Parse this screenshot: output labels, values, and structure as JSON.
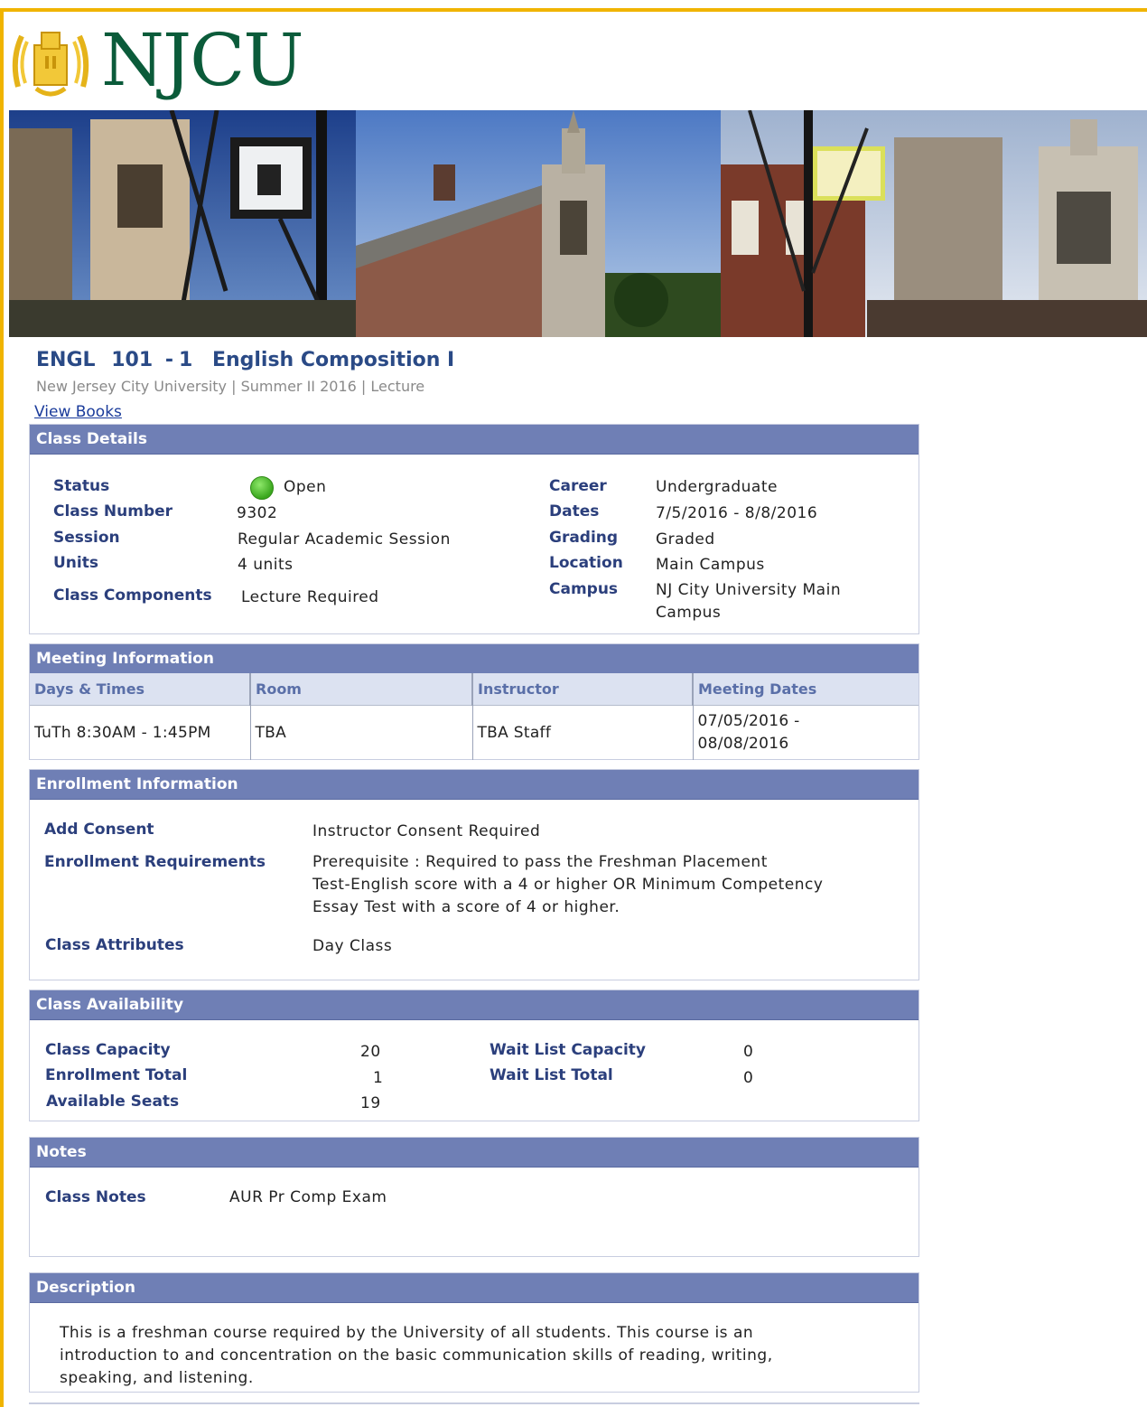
{
  "brand": {
    "logo_text": "NJCU",
    "accent_color": "#f0b400",
    "header_color": "#6f7fb5",
    "label_color": "#2b3f7c",
    "logo_color": "#0b5b3a"
  },
  "course": {
    "subject": "ENGL",
    "number": "101",
    "section": "1",
    "title": "English Composition I",
    "institution": "New Jersey City University",
    "term": "Summer II 2016",
    "component": "Lecture",
    "view_books": "View Books"
  },
  "class_details": {
    "heading": "Class Details",
    "status_label": "Status",
    "status_value": "Open",
    "status_icon": "open-status-icon",
    "class_number_label": "Class Number",
    "class_number_value": "9302",
    "session_label": "Session",
    "session_value": "Regular Academic Session",
    "units_label": "Units",
    "units_value": "4 units",
    "components_label": "Class Components",
    "components_value": "Lecture Required",
    "career_label": "Career",
    "career_value": "Undergraduate",
    "dates_label": "Dates",
    "dates_value": "7/5/2016 - 8/8/2016",
    "grading_label": "Grading",
    "grading_value": "Graded",
    "location_label": "Location",
    "location_value": "Main Campus",
    "campus_label": "Campus",
    "campus_value_1": "NJ City University Main",
    "campus_value_2": "Campus"
  },
  "meeting": {
    "heading": "Meeting Information",
    "columns": [
      "Days & Times",
      "Room",
      "Instructor",
      "Meeting Dates"
    ],
    "rows": [
      {
        "days_times": "TuTh 8:30AM - 1:45PM",
        "room": "TBA",
        "instructor": "TBA Staff",
        "dates_1": "07/05/2016 -",
        "dates_2": "08/08/2016"
      }
    ]
  },
  "enrollment": {
    "heading": "Enrollment Information",
    "consent_label": "Add Consent",
    "consent_value": "Instructor Consent Required",
    "requirements_label": "Enrollment Requirements",
    "requirements_line_1": "Prerequisite :  Required to pass the Freshman Placement",
    "requirements_line_2": "Test-English score with a 4 or higher OR Minimum Competency",
    "requirements_line_3": "Essay Test with a score of 4 or higher.",
    "attributes_label": "Class Attributes",
    "attributes_value": "Day Class"
  },
  "availability": {
    "heading": "Class Availability",
    "capacity_label": "Class Capacity",
    "capacity_value": "20",
    "enrolled_label": "Enrollment Total",
    "enrolled_value": "1",
    "available_label": "Available Seats",
    "available_value": "19",
    "wl_capacity_label": "Wait List Capacity",
    "wl_capacity_value": "0",
    "wl_total_label": "Wait List Total",
    "wl_total_value": "0"
  },
  "notes": {
    "heading": "Notes",
    "class_notes_label": "Class Notes",
    "class_notes_value": "AUR Pr Comp Exam"
  },
  "description": {
    "heading": "Description",
    "line_1": "This is a freshman course required by the University of all students.  This course is an",
    "line_2": "introduction to and concentration on the basic communication skills of reading, writing,",
    "line_3": "speaking, and listening."
  }
}
